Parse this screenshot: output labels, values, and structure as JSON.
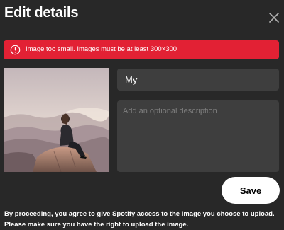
{
  "dialog": {
    "title": "Edit details",
    "close_icon": "close-icon"
  },
  "error": {
    "icon": "error-icon",
    "message": "Image too small. Images must be at least 300×300.",
    "color": "#e22134"
  },
  "form": {
    "name_value": "My",
    "description_value": "",
    "description_placeholder": "Add an optional description"
  },
  "buttons": {
    "save_label": "Save"
  },
  "footer": {
    "disclaimer": "By proceeding, you agree to give Spotify access to the image you choose to upload. Please make sure you have the right to upload the image."
  },
  "colors": {
    "background": "#282828",
    "input_background": "#3e3e3e",
    "error": "#e22134",
    "button_background": "#ffffff"
  }
}
